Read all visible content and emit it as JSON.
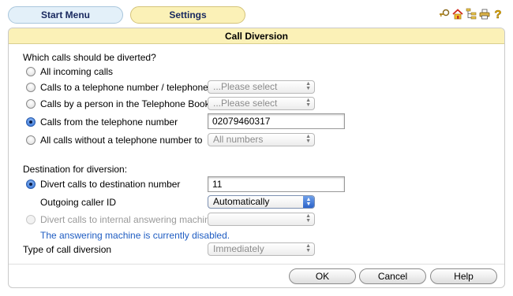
{
  "nav": {
    "start_menu": "Start Menu",
    "settings": "Settings"
  },
  "toolbar_icons": [
    "key-icon",
    "home-icon",
    "tree-icon",
    "print-icon",
    "help-icon"
  ],
  "panel": {
    "title": "Call Diversion"
  },
  "which_calls": {
    "label": "Which calls should be diverted?",
    "options": [
      {
        "label": "All incoming calls",
        "checked": false
      },
      {
        "label": "Calls to a telephone number / telephone",
        "checked": false,
        "select": "...Please select"
      },
      {
        "label": "Calls by a person in the Telephone Book",
        "checked": false,
        "select": "...Please select"
      },
      {
        "label": "Calls from the telephone number",
        "checked": true,
        "input": "02079460317"
      },
      {
        "label": "All calls without a telephone number to",
        "checked": false,
        "select": "All numbers"
      }
    ]
  },
  "destination": {
    "label": "Destination for diversion:",
    "divert_number_label": "Divert calls to destination number",
    "divert_number_value": "11",
    "caller_id_label": "Outgoing caller ID",
    "caller_id_value": "Automatically",
    "answering_machine_label": "Divert calls to internal answering machine",
    "answering_machine_value": "",
    "answering_machine_note": "The answering machine is currently disabled."
  },
  "type": {
    "label": "Type of call diversion",
    "value": "Immediately"
  },
  "buttons": {
    "ok": "OK",
    "cancel": "Cancel",
    "help": "Help"
  },
  "colors": {
    "accent_blue": "#1e5cc2",
    "header_yellow": "#fbf1b7",
    "tab_blue": "#e3f0f9"
  }
}
